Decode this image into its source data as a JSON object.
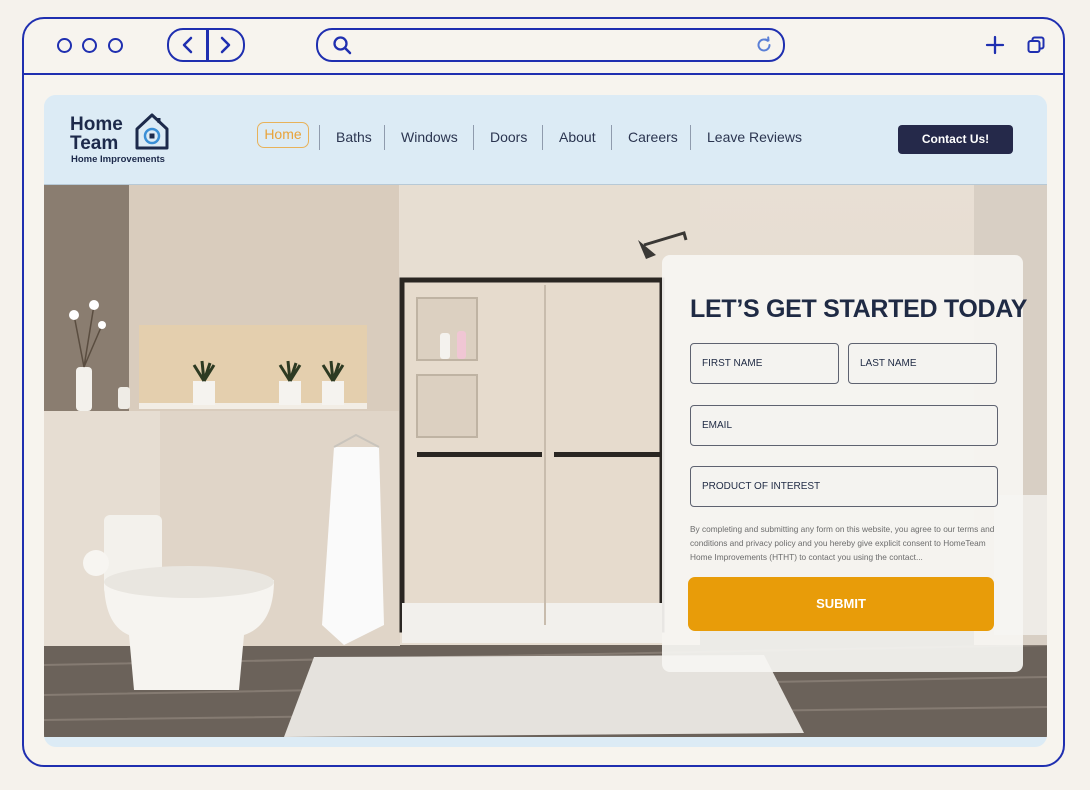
{
  "browser": {
    "window_controls": [
      "dot",
      "dot",
      "dot"
    ],
    "icons": {
      "back": "chevron-left-icon",
      "forward": "chevron-right-icon",
      "search": "search-icon",
      "reload": "reload-icon",
      "new_tab": "plus-icon",
      "tabs": "tabs-icon"
    },
    "url": ""
  },
  "site": {
    "logo": {
      "line1": "Home",
      "line2": "Team",
      "tagline": "Home Improvements",
      "icon": "house-icon"
    },
    "nav": {
      "items": [
        "Home",
        "Baths",
        "Windows",
        "Doors",
        "About",
        "Careers",
        "Leave Reviews"
      ],
      "active": "Home"
    },
    "cta": "Contact Us!"
  },
  "form": {
    "title": "LET’S GET STARTED TODAY",
    "fields": {
      "first_name": "FIRST NAME",
      "last_name": "LAST NAME",
      "email": "EMAIL",
      "product": "PRODUCT OF INTEREST"
    },
    "consent": "By completing and submitting any form on this website, you agree to our terms and conditions and privacy policy and you hereby give explicit consent to HomeTeam Home Improvements (HTHT) to contact you using the contact...",
    "submit": "SUBMIT"
  },
  "colors": {
    "browser_frame": "#1f2fb0",
    "header_bg": "#dcebf5",
    "navy": "#25294a",
    "accent_orange": "#e89c09",
    "active_nav": "#e8a33a"
  }
}
